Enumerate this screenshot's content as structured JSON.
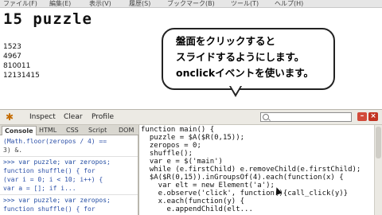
{
  "menubar": {
    "items": [
      "ファイル(F)",
      "編集(E)",
      "表示(V)",
      "履歴(S)",
      "ブックマーク(B)",
      "ツール(T)",
      "ヘルプ(H)"
    ]
  },
  "page": {
    "title": "15 puzzle",
    "rows": [
      "1523",
      "4967",
      "810011",
      "12131415"
    ]
  },
  "callout": {
    "lines": [
      "盤面をクリックすると",
      "スライドするようにします。",
      "onclickイベントを使います。"
    ]
  },
  "firebug": {
    "inspect_label": "Inspect",
    "clear_label": "Clear",
    "profile_label": "Profile",
    "search_value": "",
    "tabs": [
      "Console",
      "HTML",
      "CSS",
      "Script",
      "DOM"
    ],
    "console_lines": [
      "(Math.floor(zeropos / 4) ==",
      "3) &.",
      ">>> var puzzle; var zeropos;",
      "function shuffle() {   for",
      "(var i = 0; i < 10; i++) {",
      "  var a = [];   if i...",
      ">>> var puzzle; var zeropos;",
      "function shuffle() {   for"
    ],
    "code_lines": [
      "function main() {",
      "  puzzle = $A($R(0,15));",
      "  zeropos = 0;",
      "  shuffle();",
      "  var e = $('main')",
      "  while (e.firstChild) e.removeChild(e.firstChild);",
      "  $A($R(0,15)).inGroupsOf(4).each(function(x) {",
      "    var elt = new Element('a');",
      "    e.observe('click', function(){call_click(y)}",
      "    x.each(function(y) {",
      "      e.appendChild(elt..."
    ]
  },
  "colors": {
    "toolbar_bg": "#eceae4",
    "callout_border": "#222222",
    "console_text": "#2c50a8"
  }
}
